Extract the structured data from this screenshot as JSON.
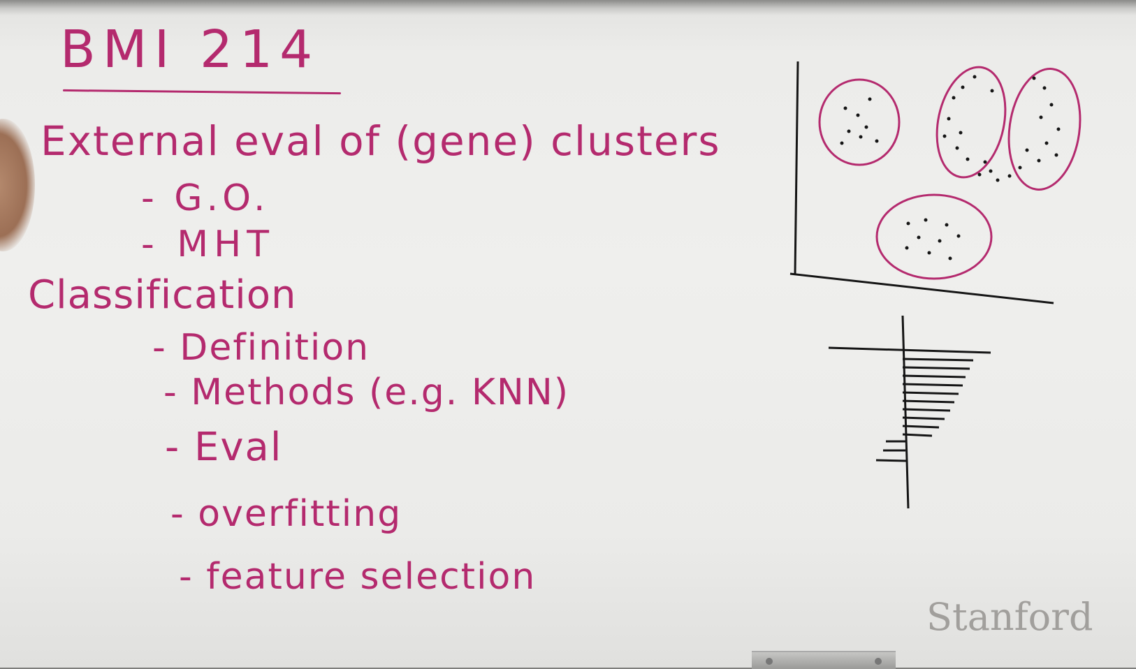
{
  "board": {
    "title": "BMI 214",
    "lines": [
      "External eval of (gene) clusters",
      "- G.O.",
      "- MHT",
      "Classification",
      "- Definition",
      "- Methods (e.g. KNN)",
      "- Eval",
      "- overfitting",
      "- feature selection"
    ]
  },
  "watermark": {
    "text": "Stanford"
  },
  "colors": {
    "marker": "#b42a6e",
    "ink": "#151515",
    "board": "#efefed"
  }
}
